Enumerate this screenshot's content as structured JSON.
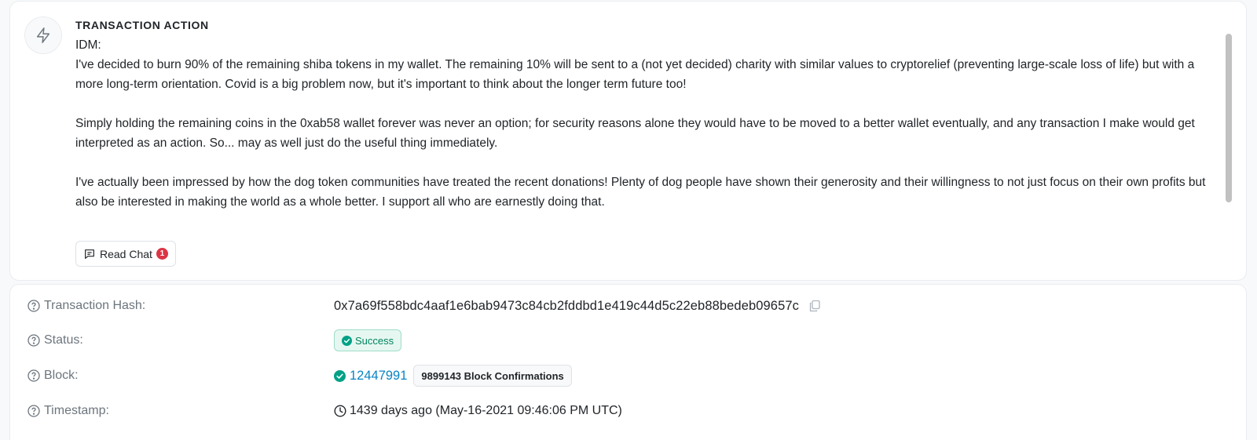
{
  "action": {
    "title": "TRANSACTION ACTION",
    "icon": "bolt-icon",
    "message_paragraphs": [
      "IDM:",
      "I've decided to burn 90% of the remaining shiba tokens in my wallet. The remaining 10% will be sent to a (not yet decided) charity with similar values to cryptorelief (preventing large-scale loss of life) but with a more long-term orientation. Covid is a big problem now, but it's important to think about the longer term future too!",
      "Simply holding the remaining coins in the 0xab58 wallet forever was never an option; for security reasons alone they would have to be moved to a better wallet eventually, and any transaction I make would get interpreted as an action. So... may as well just do the useful thing immediately.",
      "I've actually been impressed by how the dog token communities have treated the recent donations! Plenty of dog people have shown their generosity and their willingness to not just focus on their own profits but also be interested in making the world as a whole better. I support all who are earnestly doing that."
    ],
    "read_chat_label": "Read Chat",
    "read_chat_count": "1"
  },
  "details": {
    "hash_label": "Transaction Hash:",
    "hash_value": "0x7a69f558bdc4aaf1e6bab9473c84cb2fddbd1e419c44d5c22eb88bedeb09657c",
    "status_label": "Status:",
    "status_value": "Success",
    "block_label": "Block:",
    "block_value": "12447991",
    "block_confirmations": "9899143 Block Confirmations",
    "timestamp_label": "Timestamp:",
    "timestamp_value": "1439 days ago (May-16-2021 09:46:06 PM UTC)"
  },
  "colors": {
    "success": "#00a186",
    "link": "#0784c3",
    "badge_red": "#dc3545",
    "muted": "#6c757d"
  }
}
